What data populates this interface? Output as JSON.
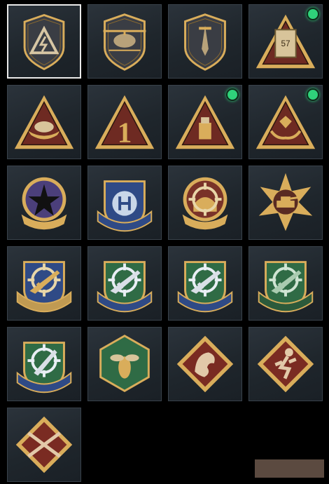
{
  "colors": {
    "gold": "#d9ad5b",
    "dark_gold": "#8b6a2f",
    "maroon": "#6e2a22",
    "navy": "#2f4a86",
    "green": "#2f6b45",
    "crimson": "#7a2b22",
    "new_indicator": "#2fd27a",
    "selection": "#e9e9e9"
  },
  "emblems": [
    {
      "icon": "lightning-triangle-emblem-icon",
      "shape": "hex-shield",
      "selected": true,
      "new": false
    },
    {
      "icon": "helicopter-emblem-icon",
      "shape": "hex-shield",
      "selected": false,
      "new": false
    },
    {
      "icon": "dagger-emblem-icon",
      "shape": "hex-shield",
      "selected": false,
      "new": false
    },
    {
      "icon": "ammo-crate-emblem-icon",
      "shape": "triangle",
      "label": "57",
      "selected": false,
      "new": true
    },
    {
      "icon": "boat-emblem-icon",
      "shape": "triangle",
      "selected": false,
      "new": false
    },
    {
      "icon": "number-one-emblem-icon",
      "shape": "triangle",
      "label": "1",
      "selected": false,
      "new": false
    },
    {
      "icon": "usb-drive-emblem-icon",
      "shape": "triangle",
      "selected": false,
      "new": true
    },
    {
      "icon": "hands-gem-emblem-icon",
      "shape": "triangle",
      "selected": false,
      "new": true
    },
    {
      "icon": "skull-star-emblem-icon",
      "shape": "round-ribbon",
      "selected": false,
      "new": false
    },
    {
      "icon": "blue-shield-stars-emblem-icon",
      "shape": "blue-shield",
      "selected": false,
      "new": false
    },
    {
      "icon": "crosshair-helmet-emblem-icon",
      "shape": "round-ribbon",
      "selected": false,
      "new": false
    },
    {
      "icon": "tank-starburst-emblem-icon",
      "shape": "sunburst",
      "selected": false,
      "new": false
    },
    {
      "icon": "gold-crosshair-rifle-emblem-icon",
      "shape": "gold-shield",
      "selected": false,
      "new": false
    },
    {
      "icon": "green-crosshair-rifle-emblem-icon",
      "shape": "green-shield",
      "selected": false,
      "new": false
    },
    {
      "icon": "blue-crosshair-rifle-emblem-icon",
      "shape": "blue-green-shield",
      "selected": false,
      "new": false
    },
    {
      "icon": "green-crosshair-sniper-emblem-icon",
      "shape": "all-green-shield",
      "selected": false,
      "new": false
    },
    {
      "icon": "crosshair-knife-emblem-icon",
      "shape": "blue-green-shield",
      "selected": false,
      "new": false
    },
    {
      "icon": "hornet-emblem-icon",
      "shape": "hexagon",
      "selected": false,
      "new": false
    },
    {
      "icon": "dragon-emblem-icon",
      "shape": "diamond",
      "selected": false,
      "new": false
    },
    {
      "icon": "running-figure-emblem-icon",
      "shape": "diamond",
      "selected": false,
      "new": false
    },
    {
      "icon": "crossed-rifles-emblem-icon",
      "shape": "diamond",
      "selected": false,
      "new": false
    }
  ]
}
